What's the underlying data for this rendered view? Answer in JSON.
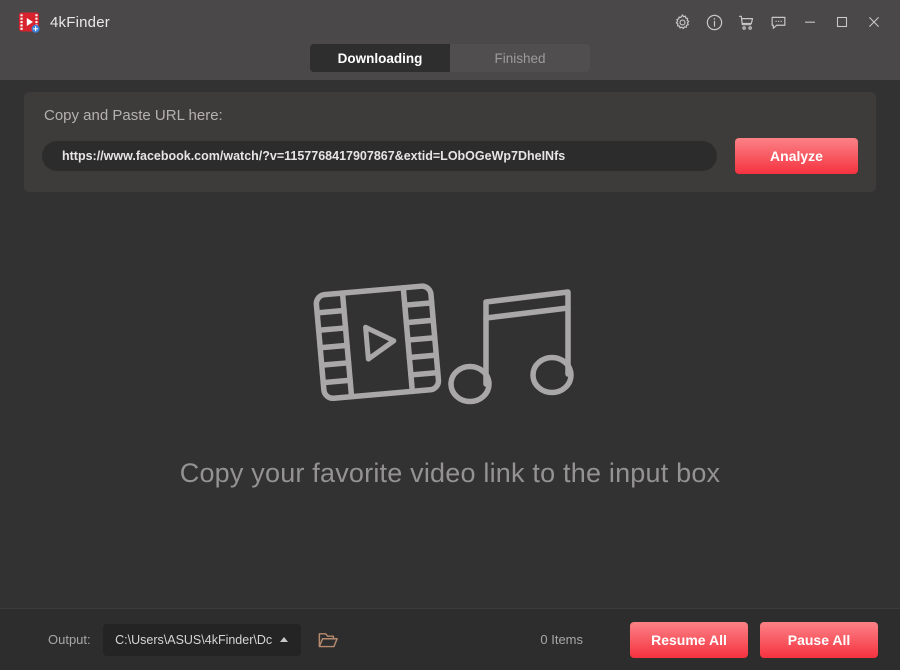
{
  "window": {
    "app_title": "4kFinder",
    "app_icon": "film-play-icon",
    "controls": [
      {
        "name": "settings",
        "icon": "gear-icon"
      },
      {
        "name": "info",
        "icon": "info-circle-icon"
      },
      {
        "name": "store",
        "icon": "shopping-cart-icon"
      },
      {
        "name": "feedback",
        "icon": "chat-bubble-icon"
      },
      {
        "name": "minimize",
        "icon": "minimize-icon"
      },
      {
        "name": "maximize",
        "icon": "maximize-icon"
      },
      {
        "name": "close",
        "icon": "close-icon"
      }
    ]
  },
  "tabs": [
    {
      "label": "Downloading",
      "active": true
    },
    {
      "label": "Finished",
      "active": false
    }
  ],
  "url_panel": {
    "label": "Copy and Paste URL here:",
    "input_value": "https://www.facebook.com/watch/?v=1157768417907867&extid=LObOGeWp7DheINfs",
    "input_placeholder": "Copy and Paste URL here",
    "analyze_label": "Analyze"
  },
  "empty_state": {
    "message": "Copy your favorite video link to the input box",
    "illustration": [
      "film-strip-play-icon",
      "music-note-icon"
    ]
  },
  "bottom_bar": {
    "output_label": "Output:",
    "output_path": "C:\\Users\\ASUS\\4kFinder\\Dc",
    "folder_icon": "open-folder-icon",
    "items_count": "0 Items",
    "resume_all_label": "Resume All",
    "pause_all_label": "Pause All"
  },
  "colors": {
    "accent_start": "#fb8186",
    "accent_end": "#f5323f",
    "titlebar_bg": "#4a4848",
    "body_bg": "#333232",
    "panel_bg": "#3e3b3b",
    "input_bg": "#2d2c2c",
    "bottom_bg": "#2e2d2d",
    "tab_active_bg": "#2f2e2e",
    "tab_inactive_bg": "#504e4e",
    "illustration_stroke": "#a9a7a7",
    "folder_icon": "#b58a6e"
  }
}
